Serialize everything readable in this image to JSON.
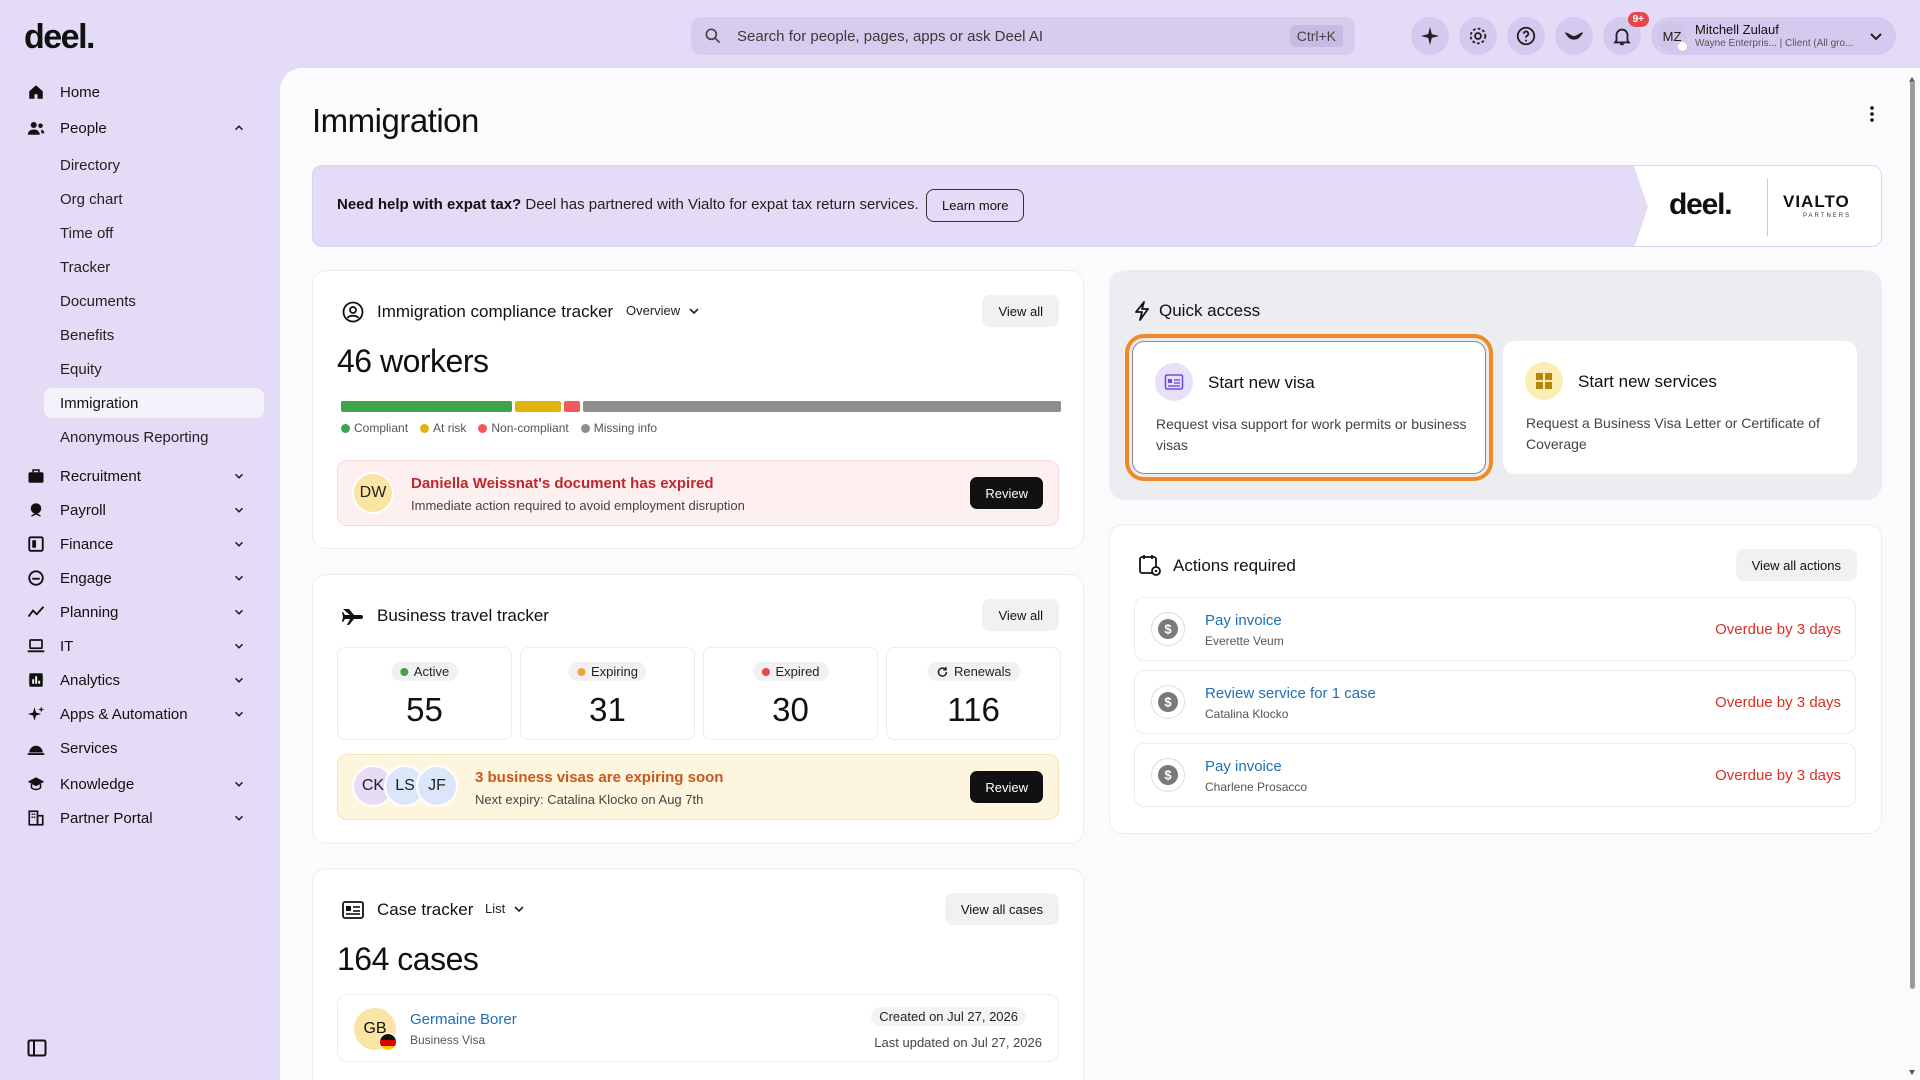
{
  "app": {
    "logo": "deel."
  },
  "search": {
    "placeholder": "Search for people, pages, apps or ask Deel AI",
    "shortcut": "Ctrl+K"
  },
  "topbar": {
    "icons": [
      "sparkle-icon",
      "gear-icon",
      "help-icon",
      "bird-icon",
      "bell-icon"
    ],
    "notification_badge": "9+",
    "user": {
      "initials": "MZ",
      "name": "Mitchell Zulauf",
      "subtitle": "Wayne Enterpris... | Client (All gro..."
    }
  },
  "sidebar": {
    "items": [
      {
        "label": "Home",
        "icon": "home-icon"
      },
      {
        "label": "People",
        "icon": "people-icon",
        "expanded": true,
        "children": [
          "Directory",
          "Org chart",
          "Time off",
          "Tracker",
          "Documents",
          "Benefits",
          "Equity",
          "Immigration",
          "Anonymous Reporting"
        ],
        "active_child": "Immigration"
      },
      {
        "label": "Recruitment",
        "icon": "briefcase-icon"
      },
      {
        "label": "Payroll",
        "icon": "payroll-icon"
      },
      {
        "label": "Finance",
        "icon": "finance-icon"
      },
      {
        "label": "Engage",
        "icon": "engage-icon"
      },
      {
        "label": "Planning",
        "icon": "chart-line-icon"
      },
      {
        "label": "IT",
        "icon": "laptop-icon"
      },
      {
        "label": "Analytics",
        "icon": "bar-chart-icon"
      },
      {
        "label": "Apps & Automation",
        "icon": "sparkle-icon"
      },
      {
        "label": "Services",
        "icon": "bell-service-icon"
      },
      {
        "label": "Knowledge",
        "icon": "graduation-cap-icon"
      },
      {
        "label": "Partner Portal",
        "icon": "building-icon"
      }
    ]
  },
  "page": {
    "title": "Immigration"
  },
  "banner": {
    "bold": "Need help with expat tax?",
    "text": " Deel has partnered with Vialto for expat tax return services.",
    "button": "Learn more",
    "brand_left": "deel.",
    "brand_right": "VIALTO",
    "brand_right_sub": "PARTNERS"
  },
  "compliance": {
    "title": "Immigration compliance tracker",
    "dropdown": "Overview",
    "view_all": "View all",
    "count": "46 workers",
    "segments": [
      {
        "label": "Compliant",
        "color": "#3ea34a",
        "share": 0.24
      },
      {
        "label": "At risk",
        "color": "#e0b40f",
        "share": 0.065
      },
      {
        "label": "Non-compliant",
        "color": "#f05a5a",
        "share": 0.022
      },
      {
        "label": "Missing info",
        "color": "#8e8e8e",
        "share": 0.673
      }
    ],
    "alert": {
      "initials": "DW",
      "title": "Daniella Weissnat's document has expired",
      "subtitle": "Immediate action required to avoid employment disruption",
      "button": "Review"
    }
  },
  "travel": {
    "title": "Business travel tracker",
    "view_all": "View all",
    "stats": [
      {
        "label": "Active",
        "value": "55",
        "dot": "#3ea34a"
      },
      {
        "label": "Expiring",
        "value": "31",
        "dot": "#f0a23c"
      },
      {
        "label": "Expired",
        "value": "30",
        "dot": "#e5484d"
      },
      {
        "label": "Renewals",
        "value": "116",
        "icon": "refresh-icon"
      }
    ],
    "alert": {
      "avatars": [
        "CK",
        "LS",
        "JF"
      ],
      "title": "3 business visas are expiring soon",
      "subtitle": "Next expiry: Catalina Klocko on Aug 7th",
      "button": "Review"
    }
  },
  "cases": {
    "title": "Case tracker",
    "dropdown": "List",
    "view_all": "View all cases",
    "count": "164 cases",
    "rows": [
      {
        "initials": "GB",
        "name": "Germaine Borer",
        "type": "Business Visa",
        "created": "Created on Jul 27, 2026",
        "updated": "Last updated on Jul 27, 2026"
      }
    ]
  },
  "quick_access": {
    "title": "Quick access",
    "cards": [
      {
        "title": "Start new visa",
        "description": "Request visa support for work permits or business visas",
        "icon": "visa-card-icon"
      },
      {
        "title": "Start new services",
        "description": "Request a Business Visa Letter or Certificate of Coverage",
        "icon": "grid-icon"
      }
    ]
  },
  "actions": {
    "title": "Actions required",
    "view_all": "View all actions",
    "rows": [
      {
        "title": "Pay invoice",
        "subtitle": "Everette Veum",
        "status": "Overdue by 3 days"
      },
      {
        "title": "Review service for 1 case",
        "subtitle": "Catalina Klocko",
        "status": "Overdue by 3 days"
      },
      {
        "title": "Pay invoice",
        "subtitle": "Charlene Prosacco",
        "status": "Overdue by 3 days"
      }
    ]
  },
  "colors": {
    "accent_purple": "#e4dcf7",
    "link_blue": "#1e6fb8",
    "overdue_red": "#d93025",
    "focus_orange": "#f08a24"
  }
}
